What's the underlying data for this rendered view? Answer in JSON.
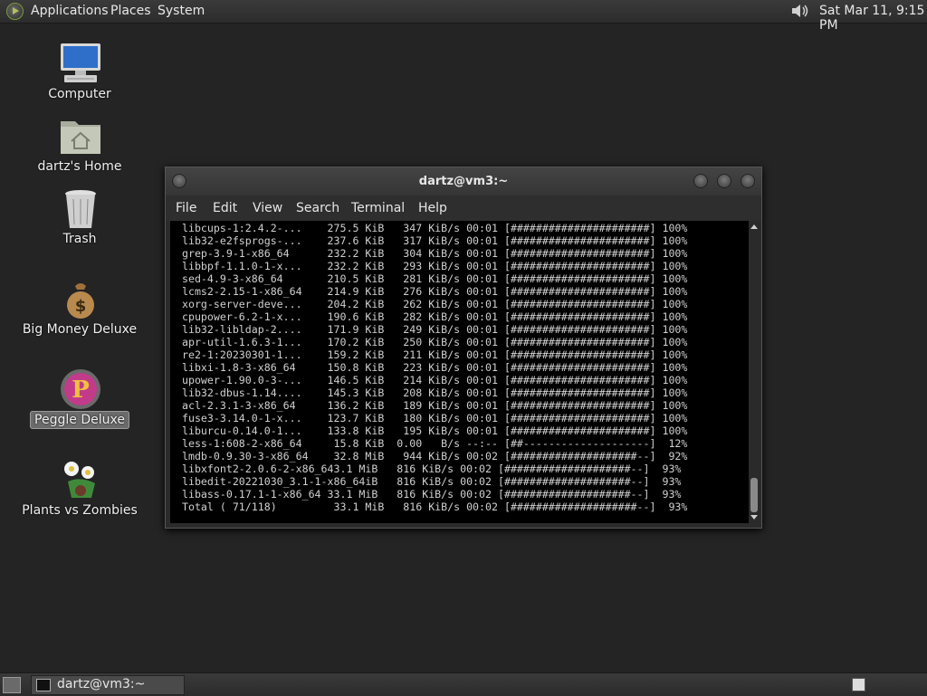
{
  "top_panel": {
    "menus": [
      "Applications",
      "Places",
      "System"
    ],
    "clock": "Sat Mar 11,  9:15 PM"
  },
  "desktop_icons": [
    {
      "label": "Computer",
      "icon": "computer-icon"
    },
    {
      "label": "dartz's Home",
      "icon": "home-folder-icon"
    },
    {
      "label": "Trash",
      "icon": "trash-icon"
    },
    {
      "label": "Big Money Deluxe",
      "icon": "money-bag-icon"
    },
    {
      "label": "Peggle Deluxe",
      "icon": "peggle-icon",
      "selected": true
    },
    {
      "label": "Plants vs Zombies",
      "icon": "flower-icon"
    }
  ],
  "terminal": {
    "title": "dartz@vm3:~",
    "menus": [
      "File",
      "Edit",
      "View",
      "Search",
      "Terminal",
      "Help"
    ],
    "lines": [
      " libcups-1:2.4.2-...    275.5 KiB   347 KiB/s 00:01 [######################] 100%",
      " lib32-e2fsprogs-...    237.6 KiB   317 KiB/s 00:01 [######################] 100%",
      " grep-3.9-1-x86_64      232.2 KiB   304 KiB/s 00:01 [######################] 100%",
      " libbpf-1.1.0-1-x...    232.2 KiB   293 KiB/s 00:01 [######################] 100%",
      " sed-4.9-3-x86_64       210.5 KiB   281 KiB/s 00:01 [######################] 100%",
      " lcms2-2.15-1-x86_64    214.9 KiB   276 KiB/s 00:01 [######################] 100%",
      " xorg-server-deve...    204.2 KiB   262 KiB/s 00:01 [######################] 100%",
      " cpupower-6.2-1-x...    190.6 KiB   282 KiB/s 00:01 [######################] 100%",
      " lib32-libldap-2....    171.9 KiB   249 KiB/s 00:01 [######################] 100%",
      " apr-util-1.6.3-1...    170.2 KiB   250 KiB/s 00:01 [######################] 100%",
      " re2-1:20230301-1...    159.2 KiB   211 KiB/s 00:01 [######################] 100%",
      " libxi-1.8-3-x86_64     150.8 KiB   223 KiB/s 00:01 [######################] 100%",
      " upower-1.90.0-3-...    146.5 KiB   214 KiB/s 00:01 [######################] 100%",
      " lib32-dbus-1.14....    145.3 KiB   208 KiB/s 00:01 [######################] 100%",
      " acl-2.3.1-3-x86_64     136.2 KiB   189 KiB/s 00:01 [######################] 100%",
      " fuse3-3.14.0-1-x...    123.7 KiB   180 KiB/s 00:01 [######################] 100%",
      " liburcu-0.14.0-1...    133.8 KiB   195 KiB/s 00:01 [######################] 100%",
      " less-1:608-2-x86_64     15.8 KiB  0.00   B/s --:-- [##--------------------]  12%",
      " lmdb-0.9.30-3-x86_64    32.8 MiB   944 KiB/s 00:02 [####################--]  92%",
      " libxfont2-2.0.6-2-x86_643.1 MiB   816 KiB/s 00:02 [####################--]  93%",
      " libedit-20221030_3.1-1-x86_64iB   816 KiB/s 00:02 [####################--]  93%",
      " libass-0.17.1-1-x86_64 33.1 MiB   816 KiB/s 00:02 [####################--]  93%",
      " Total ( 71/118)         33.1 MiB   816 KiB/s 00:02 [####################--]  93%"
    ]
  },
  "taskbar": {
    "task_label": "dartz@vm3:~"
  }
}
